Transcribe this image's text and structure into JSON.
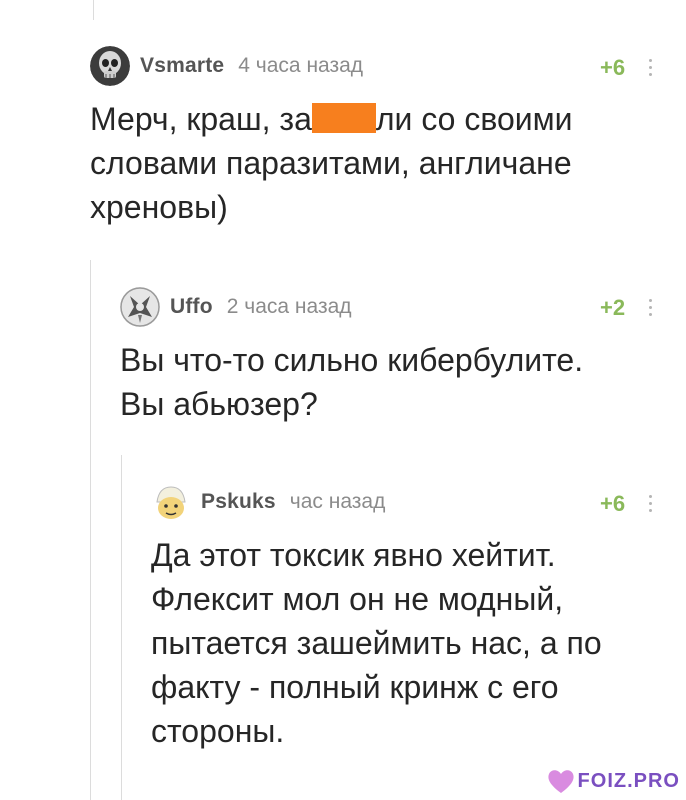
{
  "comments": [
    {
      "username": "Vsmarte",
      "time": "4 часа назад",
      "rating": "+6",
      "avatar_icon": "skull-avatar-icon",
      "text_before_redaction": "Мерч, краш, за",
      "text_after_redaction": "ли со своими",
      "lines": [
        "словами паразитами, англичане",
        "хреновы)"
      ]
    },
    {
      "username": "Uffo",
      "time": "2 часа назад",
      "rating": "+2",
      "avatar_icon": "creature-avatar-icon",
      "lines": [
        "Вы что-то сильно кибербулите.",
        "Вы абьюзер?"
      ]
    },
    {
      "username": "Pskuks",
      "time": "час назад",
      "rating": "+6",
      "avatar_icon": "cartoon-face-avatar-icon",
      "lines": [
        "Да этот токсик явно хейтит.",
        "Флексит мол он не модный,",
        "пытается зашеймить нас, а по",
        "факту - полный кринж с его",
        "стороны."
      ]
    }
  ],
  "colors": {
    "rating": "#8ab95a",
    "redaction": "#f77f1e",
    "thread_line": "#dcdcdc"
  },
  "watermark": {
    "text": "FOIZ.PRO",
    "icon": "heart-logo-icon"
  }
}
